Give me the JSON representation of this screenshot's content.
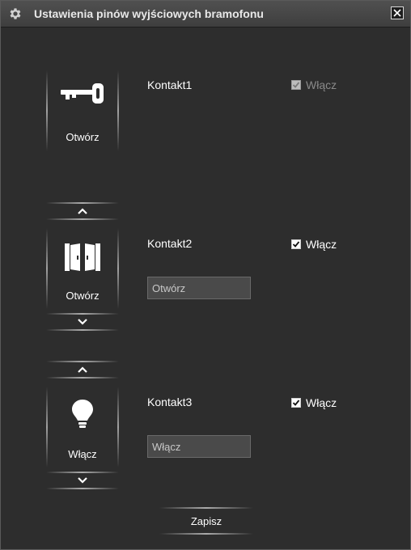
{
  "window": {
    "title": "Ustawienia pinów wyjściowych bramofonu",
    "title_icon": "gear-icon",
    "close_icon": "close-icon"
  },
  "outputs": [
    {
      "icon": "key-icon",
      "action_label": "Otwórz",
      "contact": "Kontakt1",
      "enable_label": "Włącz",
      "enabled": true,
      "enable_disabled": true
    },
    {
      "icon": "door-icon",
      "action_label": "Otwórz",
      "contact": "Kontakt2",
      "enable_label": "Włącz",
      "enabled": true,
      "input_value": "Otwórz"
    },
    {
      "icon": "lightbulb-icon",
      "action_label": "Włącz",
      "contact": "Kontakt3",
      "enable_label": "Włącz",
      "enabled": true,
      "input_value": "Włącz"
    }
  ],
  "save_label": "Zapisz",
  "colors": {
    "background": "#2d2d2d",
    "titlebar": "#454545",
    "input_bg": "#4a4a4a",
    "text": "#ffffff"
  }
}
